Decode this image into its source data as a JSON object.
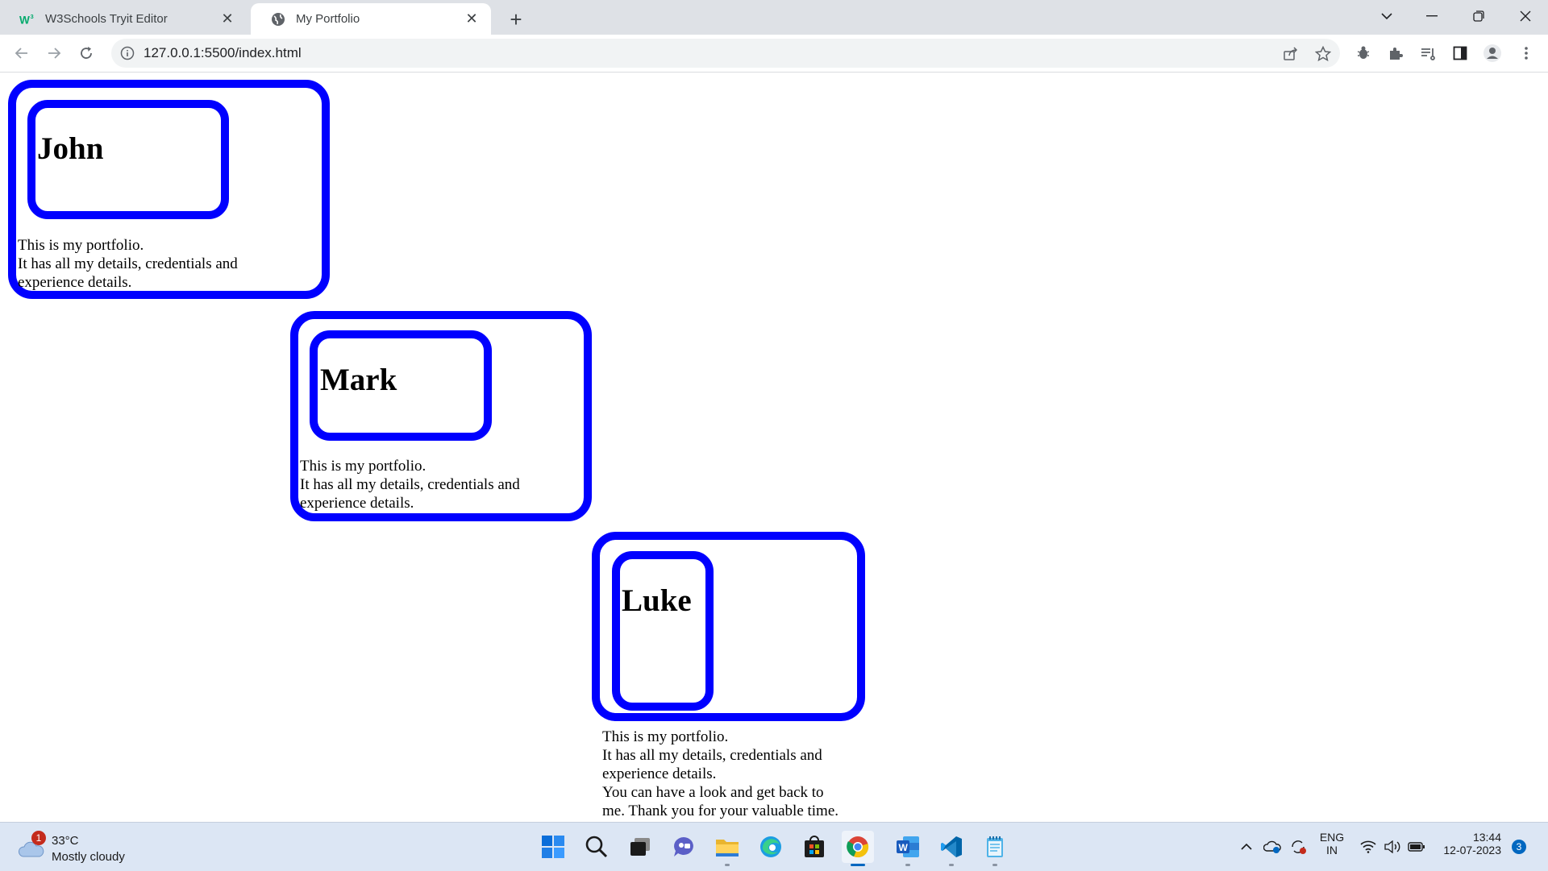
{
  "browser": {
    "tabs": [
      {
        "title": "W3Schools Tryit Editor",
        "active": false
      },
      {
        "title": "My Portfolio",
        "active": true
      }
    ],
    "url": "127.0.0.1:5500/index.html"
  },
  "cards": [
    {
      "name": "John",
      "description": [
        "This is my portfolio.",
        "It has all my details, credentials and",
        "experience details."
      ]
    },
    {
      "name": "Mark",
      "description": [
        "This is my portfolio.",
        "It has all my details, credentials and",
        "experience details."
      ]
    },
    {
      "name": "Luke",
      "description": [
        "This is my portfolio.",
        "It has all my details, credentials and",
        "experience details.",
        "You can have a look and get back to",
        "me. Thank you for your valuable time."
      ]
    }
  ],
  "taskbar": {
    "weather": {
      "temp": "33°C",
      "condition": "Mostly cloudy",
      "badge": "1"
    },
    "apps": [
      "start-icon",
      "search-icon",
      "task-view-icon",
      "chat-icon",
      "file-explorer-icon",
      "edge-icon",
      "store-icon",
      "chrome-icon",
      "word-icon",
      "vscode-icon",
      "notepad-icon"
    ],
    "language": {
      "line1": "ENG",
      "line2": "IN"
    },
    "time": "13:44",
    "date": "12-07-2023",
    "notification_count": "3"
  },
  "colors": {
    "accent": "#0000ff",
    "tabbar": "#dee1e6",
    "taskbar": "#dce6f4"
  }
}
